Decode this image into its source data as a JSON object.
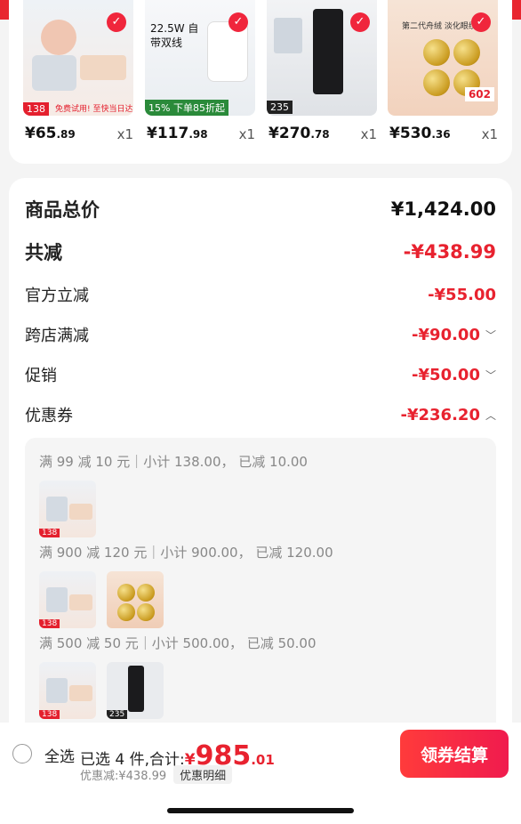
{
  "products": [
    {
      "price_int": "¥65",
      "price_dec": ".89",
      "qty": "x1",
      "thumb_text": "免费试用! 至快当日达",
      "thumb_badge": "138"
    },
    {
      "price_int": "¥117",
      "price_dec": ".98",
      "qty": "x1",
      "thumb_text": "22.5W 自带双线",
      "thumb_badge": "15% 下单85折起"
    },
    {
      "price_int": "¥270",
      "price_dec": ".78",
      "qty": "x1",
      "thumb_text": "",
      "thumb_badge": "235"
    },
    {
      "price_int": "¥530",
      "price_dec": ".36",
      "qty": "x1",
      "thumb_text": "第二代舟绒 淡化眼纹",
      "thumb_badge": "602"
    }
  ],
  "summary": {
    "total_label": "商品总价",
    "total_value": "¥1,424.00",
    "discount_label": "共减",
    "discount_value": "-¥438.99",
    "official_label": "官方立减",
    "official_value": "-¥55.00",
    "cross_label": "跨店满减",
    "cross_value": "-¥90.00",
    "promo_label": "促销",
    "promo_value": "-¥50.00",
    "coupon_label": "优惠券",
    "coupon_value": "-¥236.20"
  },
  "coupons": [
    {
      "text": "满 99 减 10 元｜小计 138.00，  已减 10.00"
    },
    {
      "text": "满 900 减 120 元｜小计 900.00，  已减 120.00"
    },
    {
      "text": "满 500 减 50 元｜小计 500.00，  已减 50.00"
    }
  ],
  "bottom": {
    "select_all": "全选",
    "selected_prefix": "已选 4 件,合计:",
    "currency": "¥",
    "total_int": "985",
    "total_dec": ".01",
    "saved_text": "优惠减:¥438.99",
    "detail_label": "优惠明细",
    "checkout_label": "领券结算"
  },
  "colors": {
    "accent": "#e8222f",
    "button": "#f01b4e"
  }
}
